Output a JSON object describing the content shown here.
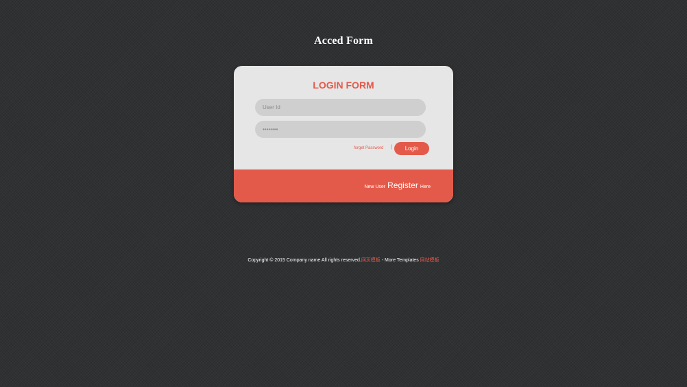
{
  "page": {
    "title": "Acced Form"
  },
  "login_form": {
    "heading": "LOGIN FORM",
    "user_id_placeholder": "User Id",
    "password_placeholder": "••••••••",
    "forgot_password": "forget Password",
    "divider": "|",
    "login_label": "Login",
    "new_user_text": "New User",
    "register_label": "Register",
    "here_text": "Here"
  },
  "footer": {
    "copyright": "Copyright © 2015 Company name All rights reserved.",
    "link1": "网页模板",
    "separator": " - More Templates ",
    "link2": "网站模板"
  },
  "colors": {
    "background": "#2f3133",
    "card": "#e6e6e6",
    "accent": "#e45a4a",
    "field": "#cfcfcf"
  }
}
